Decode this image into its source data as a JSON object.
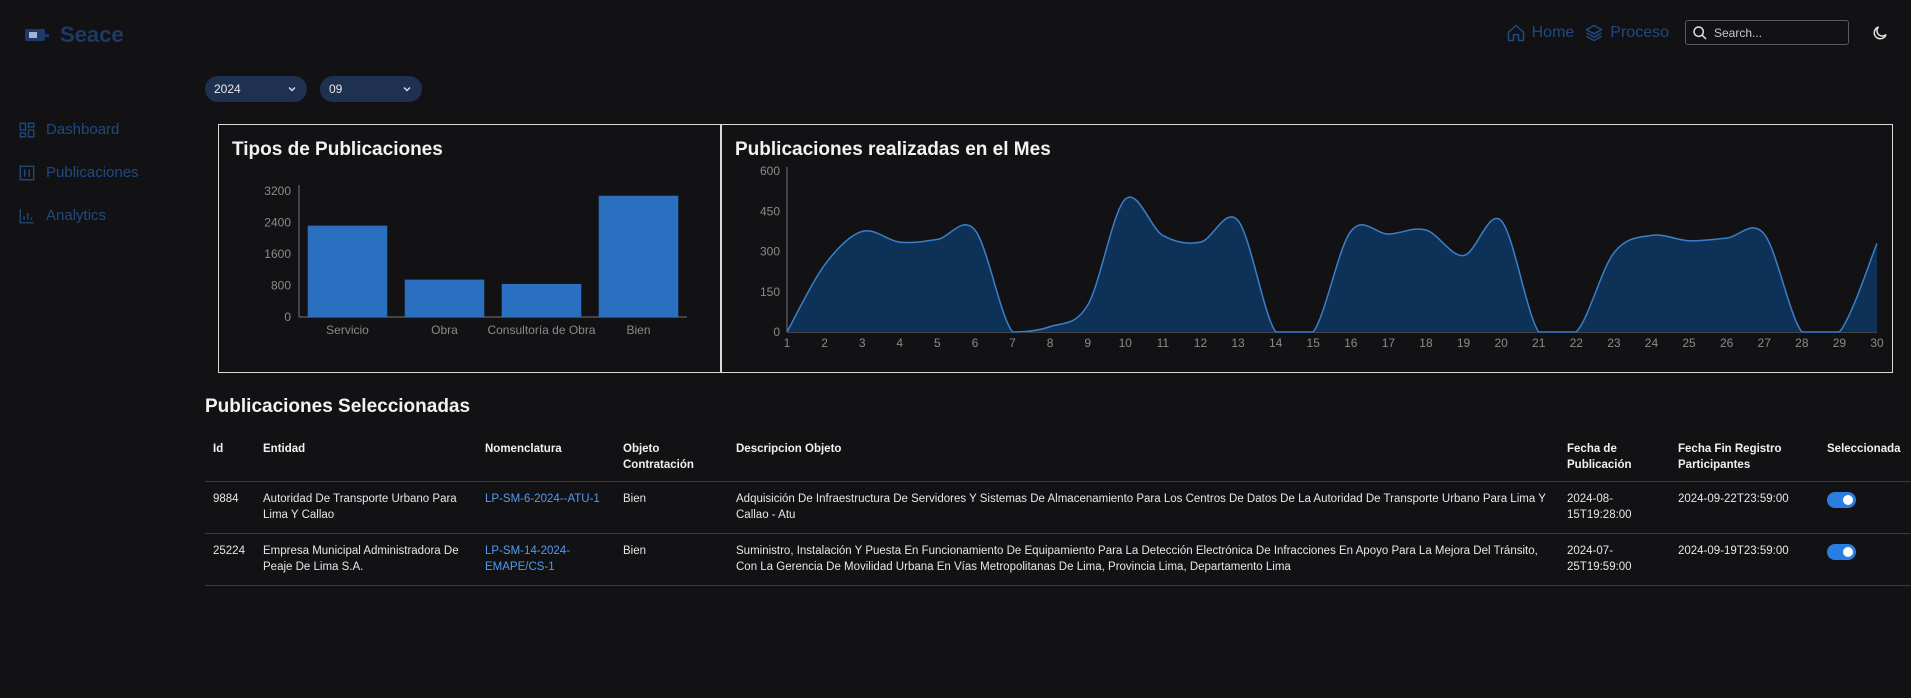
{
  "header": {
    "brand": "Seace",
    "nav": [
      {
        "label": "Home",
        "icon": "home-icon"
      },
      {
        "label": "Proceso",
        "icon": "layers-icon"
      }
    ],
    "search_placeholder": "Search...",
    "theme_icon": "moon-icon"
  },
  "sidebar": {
    "items": [
      {
        "label": "Dashboard",
        "icon": "dashboard-icon"
      },
      {
        "label": "Publicaciones",
        "icon": "columns-icon"
      },
      {
        "label": "Analytics",
        "icon": "bar-chart-icon"
      }
    ]
  },
  "filters": {
    "year": "2024",
    "month": "09"
  },
  "colors": {
    "accent": "#2a6fc0",
    "area_fill": "#0e3158",
    "area_stroke": "#3a7fc8",
    "link": "#4f9cf0",
    "toggle": "#2a7de1"
  },
  "chart_data": [
    {
      "type": "bar",
      "title": "Tipos de Publicaciones",
      "categories": [
        "Servicio",
        "Obra",
        "Consultoría de Obra",
        "Bien"
      ],
      "values": [
        2320,
        950,
        840,
        3080
      ],
      "yticks": [
        0,
        800,
        1600,
        2400,
        3200
      ],
      "ylim": [
        0,
        3200
      ]
    },
    {
      "type": "area",
      "title": "Publicaciones realizadas en el Mes",
      "x": [
        "1",
        "2",
        "3",
        "4",
        "5",
        "6",
        "7",
        "8",
        "9",
        "10",
        "11",
        "12",
        "13",
        "14",
        "15",
        "16",
        "17",
        "18",
        "19",
        "20",
        "21",
        "22",
        "23",
        "24",
        "25",
        "26",
        "27",
        "28",
        "29",
        "30"
      ],
      "values": [
        0,
        250,
        375,
        335,
        345,
        380,
        0,
        20,
        100,
        495,
        360,
        335,
        415,
        0,
        0,
        375,
        365,
        380,
        285,
        415,
        0,
        0,
        295,
        360,
        340,
        350,
        365,
        0,
        0,
        330
      ],
      "yticks": [
        0,
        150,
        300,
        450,
        600
      ],
      "ylim": [
        0,
        600
      ]
    }
  ],
  "table": {
    "title": "Publicaciones Seleccionadas",
    "headers": [
      "Id",
      "Entidad",
      "Nomenclatura",
      "Objeto Contratación",
      "Descripcion Objeto",
      "Fecha de Publicación",
      "Fecha Fin Registro Participantes",
      "Seleccionada"
    ],
    "rows": [
      {
        "id": "9884",
        "entidad": "Autoridad De Transporte Urbano Para Lima Y Callao",
        "nomenclatura": "LP-SM-6-2024--ATU-1",
        "objeto": "Bien",
        "descripcion": "Adquisición De Infraestructura De Servidores Y Sistemas De Almacenamiento Para Los Centros De Datos De La Autoridad De Transporte Urbano Para Lima Y Callao - Atu",
        "fecha_pub": "2024-08-15T19:28:00",
        "fecha_fin": "2024-09-22T23:59:00"
      },
      {
        "id": "25224",
        "entidad": "Empresa Municipal Administradora De Peaje De Lima S.A.",
        "nomenclatura": "LP-SM-14-2024-EMAPE/CS-1",
        "objeto": "Bien",
        "descripcion": "Suministro, Instalación Y Puesta En Funcionamiento De Equipamiento Para La Detección Electrónica De Infracciones En Apoyo Para La Mejora Del Tránsito, Con La Gerencia De Movilidad Urbana En Vías Metropolitanas De Lima, Provincia Lima, Departamento Lima",
        "fecha_pub": "2024-07-25T19:59:00",
        "fecha_fin": "2024-09-19T23:59:00"
      }
    ]
  }
}
